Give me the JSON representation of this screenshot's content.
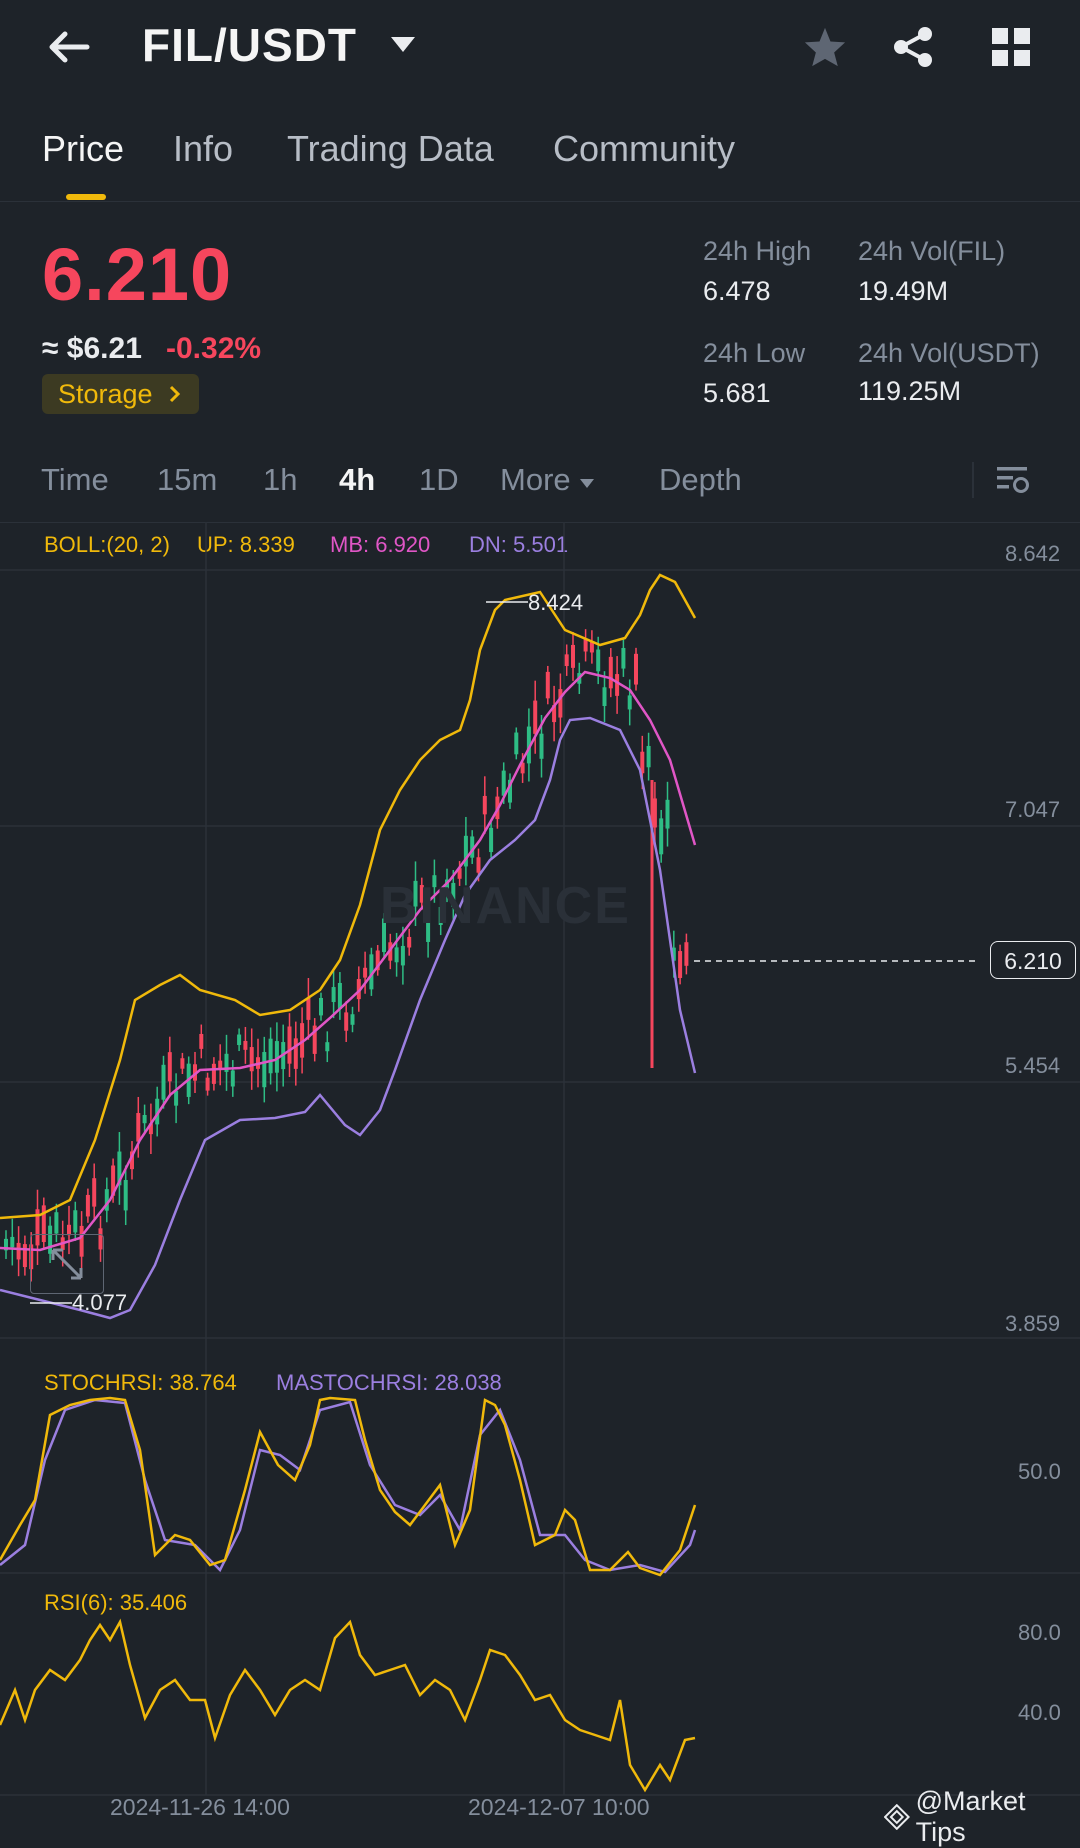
{
  "header": {
    "pair": "FIL/USDT"
  },
  "tabs": [
    "Price",
    "Info",
    "Trading Data",
    "Community"
  ],
  "price": {
    "last": "6.210",
    "usd": "≈ $6.21",
    "change": "-0.32%",
    "tag": "Storage",
    "stats": {
      "high_label": "24h High",
      "high": "6.478",
      "low_label": "24h Low",
      "low": "5.681",
      "vol_fil_label": "24h Vol(FIL)",
      "vol_fil": "19.49M",
      "vol_usdt_label": "24h Vol(USDT)",
      "vol_usdt": "119.25M"
    }
  },
  "intervals": [
    "Time",
    "15m",
    "1h",
    "4h",
    "1D",
    "More",
    "Depth"
  ],
  "active_interval": "4h",
  "boll": {
    "label": "BOLL:(20, 2)",
    "up": "UP: 8.339",
    "mb": "MB: 6.920",
    "dn": "DN: 5.501"
  },
  "axis": {
    "price_ticks": [
      "8.642",
      "7.047",
      "5.454",
      "3.859"
    ],
    "current_price": "6.210",
    "max_label": "8.424",
    "min_label": "4.077",
    "stoch_tick": "50.0",
    "rsi_ticks": [
      "80.0",
      "40.0"
    ],
    "dates": [
      "2024-11-26 14:00",
      "2024-12-07 10:00"
    ]
  },
  "stochrsi": {
    "label": "STOCHRSI: 38.764",
    "ma_label": "MASTOCHRSI: 28.038"
  },
  "rsi": {
    "label": "RSI(6): 35.406"
  },
  "watermark": "BINANCE",
  "credit": "@Market Tips",
  "colors": {
    "bg": "#1e2329",
    "up": "#2ebd85",
    "down": "#f6465d",
    "accent": "#f0b90b",
    "boll_up": "#f0b90b",
    "boll_mb": "#e056c6",
    "boll_dn": "#9b7fe0"
  },
  "icons": [
    "back-arrow-icon",
    "caret-down-icon",
    "star-icon",
    "share-icon",
    "grid-icon",
    "chevron-right-icon",
    "chart-settings-icon",
    "expand-icon"
  ]
}
